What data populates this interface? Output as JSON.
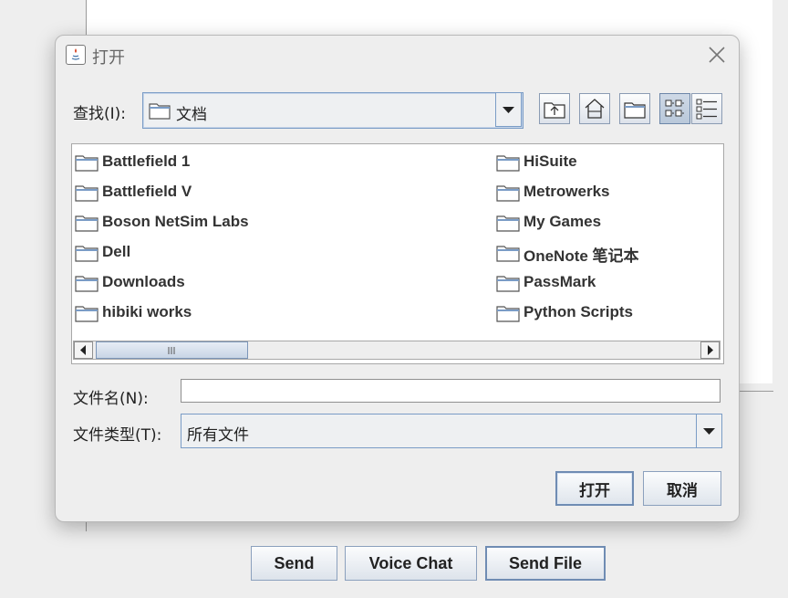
{
  "dialog": {
    "title": "打开",
    "lookin_label": "查找(I):",
    "lookin_value": "文档",
    "toolbar": [
      "up-folder-icon",
      "home-icon",
      "new-folder-icon",
      "list-view-icon",
      "details-view-icon"
    ],
    "files_left": [
      "Battlefield 1",
      "Battlefield V",
      "Boson NetSim Labs",
      "Dell",
      "Downloads",
      "hibiki works"
    ],
    "files_right": [
      "HiSuite",
      "Metrowerks",
      "My Games",
      "OneNote 笔记本",
      "PassMark",
      "Python Scripts"
    ],
    "filename_label": "文件名(N):",
    "filename_value": "",
    "filetype_label": "文件类型(T):",
    "filetype_value": "所有文件",
    "open_button": "打开",
    "cancel_button": "取消"
  },
  "app": {
    "send_button": "Send",
    "voice_chat_button": "Voice Chat",
    "send_file_button": "Send File"
  }
}
